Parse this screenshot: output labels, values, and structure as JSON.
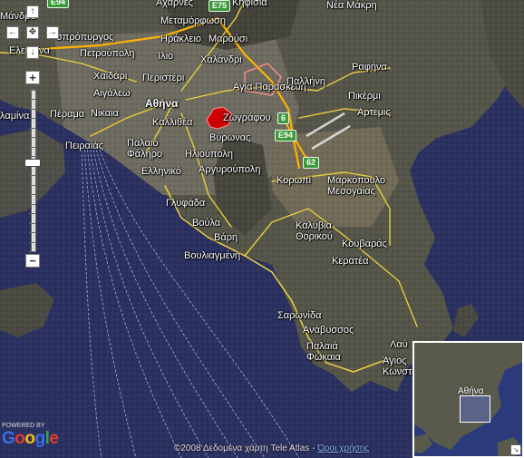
{
  "map": {
    "type": "satellite",
    "region": "Attica",
    "colors": {
      "sea": "#2b3160",
      "land": "#5a5a4c",
      "road": "#e6cc40",
      "highway": "#ffb300",
      "marker": "#cc0000",
      "shield": "#3c9a3c"
    }
  },
  "labels": {
    "mandra": "Μάνδρα",
    "acharnes": "Αχαρνές",
    "kifisia": "Κηφισιά",
    "nea_makri": "Νέα Μάκρη",
    "metamorfosi": "Μεταμόρφωση",
    "aspropyrgos": "σπρόπυργος",
    "irakleio": "Ηράκλειο",
    "marousi": "Μαρούσι",
    "elefsina": "Ελευσίνα",
    "petroupoli": "Πετρούπολη",
    "ilio": "Ίλιο",
    "chalandri": "Χαλάνδρι",
    "rafina": "Ραφήνα",
    "chaidari": "Χαϊδάρι",
    "peristeri": "Περιστέρι",
    "aigaleo": "Αιγάλεω",
    "agia_paraskevi": "Αγία Παρασκευή",
    "pallini": "Παλλήνη",
    "pikermi": "Πικέρμι",
    "salamina": "λαμίνα",
    "perama": "Πέραμα",
    "nikaia": "Νίκαια",
    "athina": "Αθήνα",
    "kallithea": "Καλλιθέα",
    "zografou": "Ζωγράφου",
    "artemis": "Άρτεμις",
    "peiraias": "Πειραιάς",
    "palaio_faliro": "Παλαιό Φάληρο",
    "vyronas": "Βύρωνας",
    "ilioupoli": "Ηλιούπολη",
    "elliniko": "Ελληνικό",
    "argyroupoli": "Αργυρούπολη",
    "koropi": "Κορωπί",
    "markopoulo": "Μαρκόπουλο Μεσογαίας",
    "glyfada": "Γλυφάδα",
    "voula": "Βούλα",
    "kalyvia": "Καλύβια Θορικού",
    "vari": "Βάρη",
    "kouvaras": "Κουβαράς",
    "vouliagmeni": "Βουλιαγμένη",
    "keratea": "Κερατέα",
    "saronida": "Σαρωνίδα",
    "anavyssos": "Ανάβυσσος",
    "palaia_fokaia": "Παλαιά Φώκαια",
    "agios_konstantinos": "Άγιος Κωνσταντίνος",
    "lavrio": "Λαύ"
  },
  "shields": {
    "e75": "E75",
    "e94_top": "E94",
    "six": "6",
    "e94": "E94",
    "sixty_two": "62"
  },
  "controls": {
    "pan_up": "↑",
    "pan_left": "←",
    "pan_center": "✥",
    "pan_right": "→",
    "pan_down": "↓",
    "zoom_in": "+",
    "zoom_out": "−",
    "zoom_level_fraction": 0.43
  },
  "overview": {
    "label": "Αθήνα",
    "toggle": "↘"
  },
  "footer": {
    "powered_by": "POWERED BY",
    "logo": [
      "G",
      "o",
      "o",
      "g",
      "l",
      "e"
    ],
    "logo_colors": [
      "#3a6ee8",
      "#e53b2c",
      "#f4c20d",
      "#3a6ee8",
      "#2fa84f",
      "#e53b2c"
    ],
    "copyright": "©2008 Δεδομένα χάρτη Tele Atlas - ",
    "terms": "Όροι χρήσης"
  }
}
